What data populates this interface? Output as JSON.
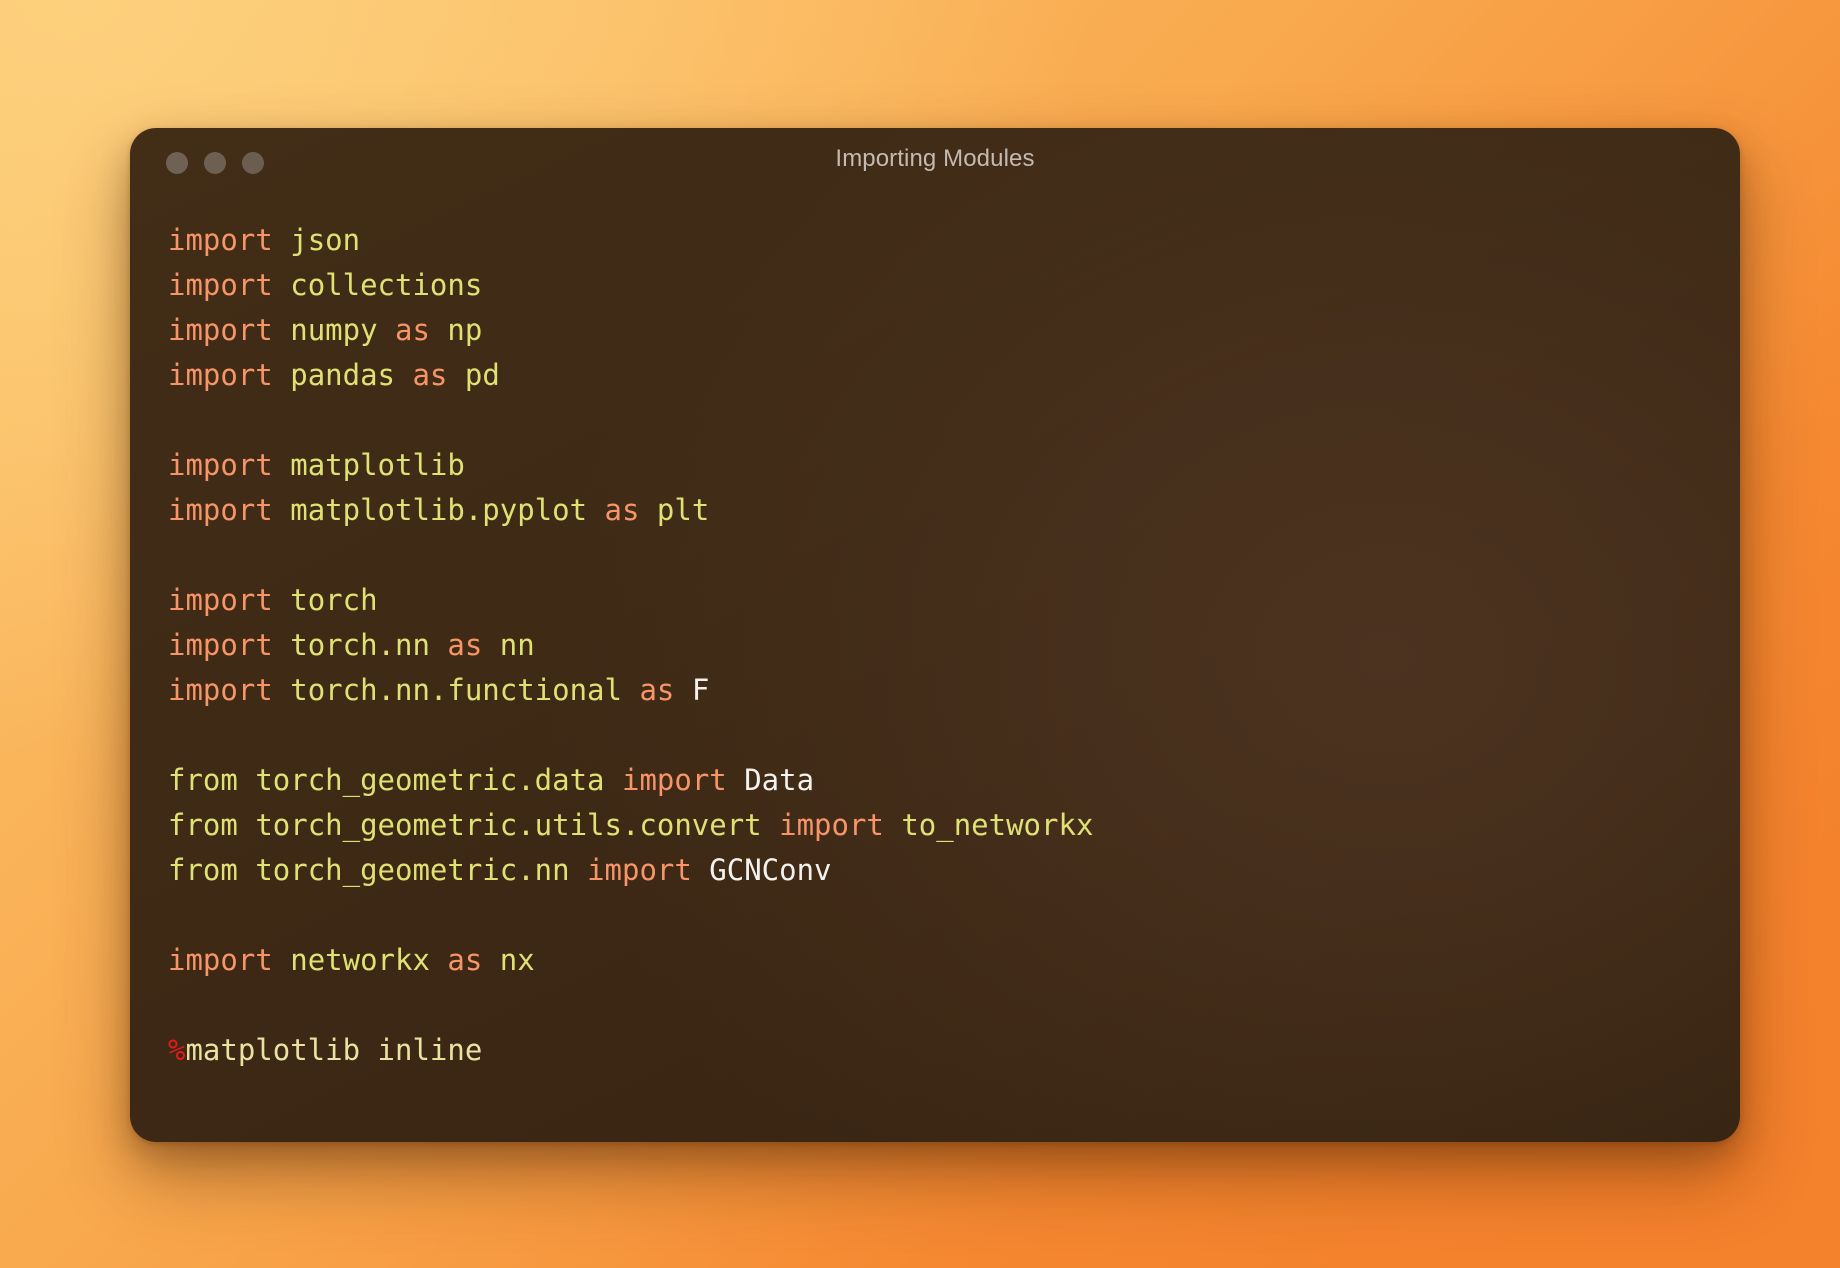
{
  "window": {
    "title": "Importing Modules",
    "traffic_lights": [
      {
        "name": "close",
        "color": "#6f6255"
      },
      {
        "name": "minimize",
        "color": "#6d6053"
      },
      {
        "name": "zoom",
        "color": "#6b5e51"
      }
    ]
  },
  "theme": {
    "background_start": "#fbc66e",
    "background_end": "#f47f2a",
    "window_background": "#3e2a15",
    "title_color": "#c3bab1",
    "keyword_color": "#f79468",
    "module_color": "#dfe273",
    "class_color": "#f4f2ef",
    "magic_color": "#e21b18",
    "magic_body_color": "#e9e3a2"
  },
  "code": {
    "language": "python",
    "lines": [
      {
        "n": 1,
        "text": "import json",
        "tokens": [
          {
            "t": "import",
            "c": "kw"
          },
          {
            "t": " ",
            "c": "sp"
          },
          {
            "t": "json",
            "c": "mod"
          }
        ]
      },
      {
        "n": 2,
        "text": "import collections",
        "tokens": [
          {
            "t": "import",
            "c": "kw"
          },
          {
            "t": " ",
            "c": "sp"
          },
          {
            "t": "collections",
            "c": "mod"
          }
        ]
      },
      {
        "n": 3,
        "text": "import numpy as np",
        "tokens": [
          {
            "t": "import",
            "c": "kw"
          },
          {
            "t": " ",
            "c": "sp"
          },
          {
            "t": "numpy",
            "c": "mod"
          },
          {
            "t": " ",
            "c": "sp"
          },
          {
            "t": "as",
            "c": "kw"
          },
          {
            "t": " ",
            "c": "sp"
          },
          {
            "t": "np",
            "c": "mod"
          }
        ]
      },
      {
        "n": 4,
        "text": "import pandas as pd",
        "tokens": [
          {
            "t": "import",
            "c": "kw"
          },
          {
            "t": " ",
            "c": "sp"
          },
          {
            "t": "pandas",
            "c": "mod"
          },
          {
            "t": " ",
            "c": "sp"
          },
          {
            "t": "as",
            "c": "kw"
          },
          {
            "t": " ",
            "c": "sp"
          },
          {
            "t": "pd",
            "c": "mod"
          }
        ]
      },
      {
        "n": 5,
        "text": "",
        "tokens": []
      },
      {
        "n": 6,
        "text": "import matplotlib",
        "tokens": [
          {
            "t": "import",
            "c": "kw"
          },
          {
            "t": " ",
            "c": "sp"
          },
          {
            "t": "matplotlib",
            "c": "mod"
          }
        ]
      },
      {
        "n": 7,
        "text": "import matplotlib.pyplot as plt",
        "tokens": [
          {
            "t": "import",
            "c": "kw"
          },
          {
            "t": " ",
            "c": "sp"
          },
          {
            "t": "matplotlib.pyplot",
            "c": "mod"
          },
          {
            "t": " ",
            "c": "sp"
          },
          {
            "t": "as",
            "c": "kw"
          },
          {
            "t": " ",
            "c": "sp"
          },
          {
            "t": "plt",
            "c": "mod"
          }
        ]
      },
      {
        "n": 8,
        "text": "",
        "tokens": []
      },
      {
        "n": 9,
        "text": "import torch",
        "tokens": [
          {
            "t": "import",
            "c": "kw"
          },
          {
            "t": " ",
            "c": "sp"
          },
          {
            "t": "torch",
            "c": "mod"
          }
        ]
      },
      {
        "n": 10,
        "text": "import torch.nn as nn",
        "tokens": [
          {
            "t": "import",
            "c": "kw"
          },
          {
            "t": " ",
            "c": "sp"
          },
          {
            "t": "torch.nn",
            "c": "mod"
          },
          {
            "t": " ",
            "c": "sp"
          },
          {
            "t": "as",
            "c": "kw"
          },
          {
            "t": " ",
            "c": "sp"
          },
          {
            "t": "nn",
            "c": "mod"
          }
        ]
      },
      {
        "n": 11,
        "text": "import torch.nn.functional as F",
        "tokens": [
          {
            "t": "import",
            "c": "kw"
          },
          {
            "t": " ",
            "c": "sp"
          },
          {
            "t": "torch.nn.functional",
            "c": "mod"
          },
          {
            "t": " ",
            "c": "sp"
          },
          {
            "t": "as",
            "c": "kw"
          },
          {
            "t": " ",
            "c": "sp"
          },
          {
            "t": "F",
            "c": "cls"
          }
        ]
      },
      {
        "n": 12,
        "text": "",
        "tokens": []
      },
      {
        "n": 13,
        "text": "from torch_geometric.data import Data",
        "tokens": [
          {
            "t": "from",
            "c": "mod"
          },
          {
            "t": " ",
            "c": "sp"
          },
          {
            "t": "torch_geometric.data",
            "c": "mod"
          },
          {
            "t": " ",
            "c": "sp"
          },
          {
            "t": "import",
            "c": "kw"
          },
          {
            "t": " ",
            "c": "sp"
          },
          {
            "t": "Data",
            "c": "cls"
          }
        ]
      },
      {
        "n": 14,
        "text": "from torch_geometric.utils.convert import to_networkx",
        "tokens": [
          {
            "t": "from",
            "c": "mod"
          },
          {
            "t": " ",
            "c": "sp"
          },
          {
            "t": "torch_geometric.utils.convert",
            "c": "mod"
          },
          {
            "t": " ",
            "c": "sp"
          },
          {
            "t": "import",
            "c": "kw"
          },
          {
            "t": " ",
            "c": "sp"
          },
          {
            "t": "to_networkx",
            "c": "mod"
          }
        ]
      },
      {
        "n": 15,
        "text": "from torch_geometric.nn import GCNConv",
        "tokens": [
          {
            "t": "from",
            "c": "mod"
          },
          {
            "t": " ",
            "c": "sp"
          },
          {
            "t": "torch_geometric.nn",
            "c": "mod"
          },
          {
            "t": " ",
            "c": "sp"
          },
          {
            "t": "import",
            "c": "kw"
          },
          {
            "t": " ",
            "c": "sp"
          },
          {
            "t": "GCNConv",
            "c": "cls"
          }
        ]
      },
      {
        "n": 16,
        "text": "",
        "tokens": []
      },
      {
        "n": 17,
        "text": "import networkx as nx",
        "tokens": [
          {
            "t": "import",
            "c": "kw"
          },
          {
            "t": " ",
            "c": "sp"
          },
          {
            "t": "networkx",
            "c": "mod"
          },
          {
            "t": " ",
            "c": "sp"
          },
          {
            "t": "as",
            "c": "kw"
          },
          {
            "t": " ",
            "c": "sp"
          },
          {
            "t": "nx",
            "c": "mod"
          }
        ]
      },
      {
        "n": 18,
        "text": "",
        "tokens": []
      },
      {
        "n": 19,
        "text": "%matplotlib inline",
        "tokens": [
          {
            "t": "%",
            "c": "magic"
          },
          {
            "t": "matplotlib inline",
            "c": "plain"
          }
        ]
      }
    ]
  }
}
